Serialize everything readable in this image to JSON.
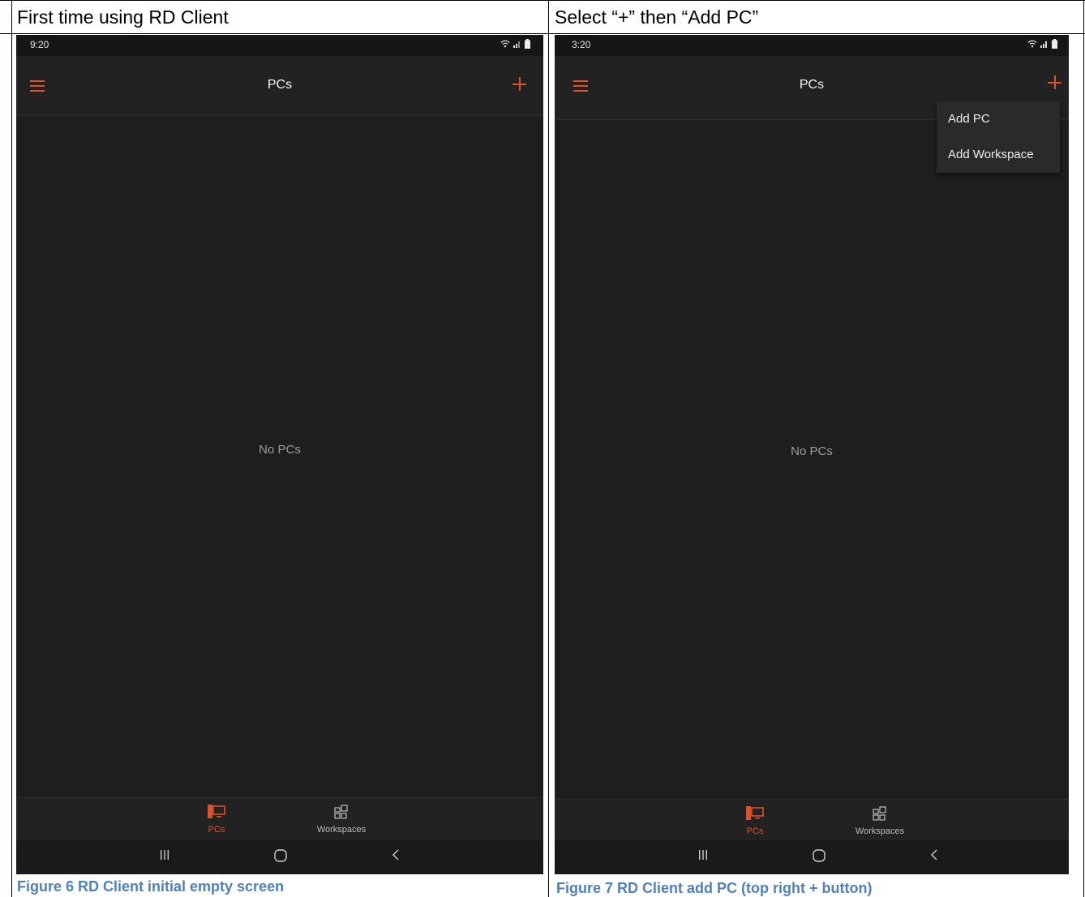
{
  "doc": {
    "left_header": "First time using RD Client",
    "right_header": "Select “+” then “Add PC”",
    "left_caption": "Figure 6  RD Client initial empty screen",
    "right_caption": "Figure 7  RD Client add PC (top right + button)"
  },
  "colors": {
    "accent": "#e0502a",
    "background": "#1e1e1e",
    "caption": "#4f81bd"
  },
  "screen1": {
    "status_time": "9:20",
    "title": "PCs",
    "empty_text": "No PCs",
    "nav": {
      "pcs_label": "PCs",
      "workspaces_label": "Workspaces",
      "active": "PCs"
    },
    "icons": [
      "menu-icon",
      "add-icon",
      "pc-icon",
      "workspaces-icon",
      "recents-icon",
      "home-icon",
      "back-icon",
      "wifi-icon",
      "signal-icon",
      "battery-icon"
    ]
  },
  "screen2": {
    "status_time": "3:20",
    "title": "PCs",
    "empty_text": "No PCs",
    "nav": {
      "pcs_label": "PCs",
      "workspaces_label": "Workspaces",
      "active": "PCs"
    },
    "menu": {
      "items": [
        "Add PC",
        "Add Workspace"
      ]
    }
  }
}
